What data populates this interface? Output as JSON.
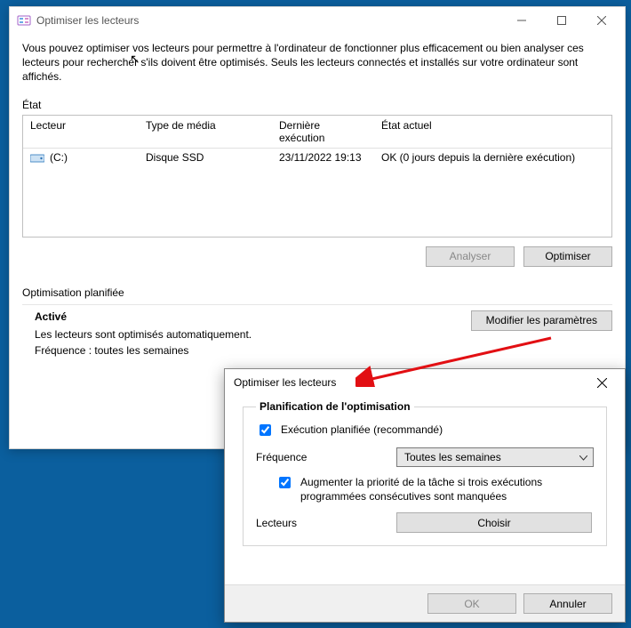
{
  "window": {
    "title": "Optimiser les lecteurs",
    "desc": "Vous pouvez optimiser vos lecteurs pour permettre à l'ordinateur de fonctionner plus efficacement ou bien analyser ces lecteurs pour rechercher s'ils doivent être optimisés. Seuls les lecteurs connectés et installés sur votre ordinateur sont affichés.",
    "state_label": "État",
    "columns": {
      "drive": "Lecteur",
      "media": "Type de média",
      "last": "Dernière exécution",
      "state": "État actuel"
    },
    "row": {
      "drive": "(C:)",
      "media": "Disque SSD",
      "last": "23/11/2022 19:13",
      "state": "OK (0 jours depuis la dernière exécution)"
    },
    "buttons": {
      "analyze": "Analyser",
      "optimize": "Optimiser"
    },
    "sched_header": "Optimisation planifiée",
    "sched_activated": "Activé",
    "sched_line1": "Les lecteurs sont optimisés automatiquement.",
    "sched_line2": "Fréquence : toutes les semaines",
    "modify_btn": "Modifier les paramètres"
  },
  "dialog": {
    "title": "Optimiser les lecteurs",
    "section_title": "Planification de l'optimisation",
    "chk_schedule": "Exécution planifiée (recommandé)",
    "freq_label": "Fréquence",
    "freq_value": "Toutes les semaines",
    "chk_priority": "Augmenter la priorité de la tâche si trois exécutions programmées consécutives sont manquées",
    "drives_label": "Lecteurs",
    "choose_btn": "Choisir",
    "ok": "OK",
    "cancel": "Annuler"
  }
}
